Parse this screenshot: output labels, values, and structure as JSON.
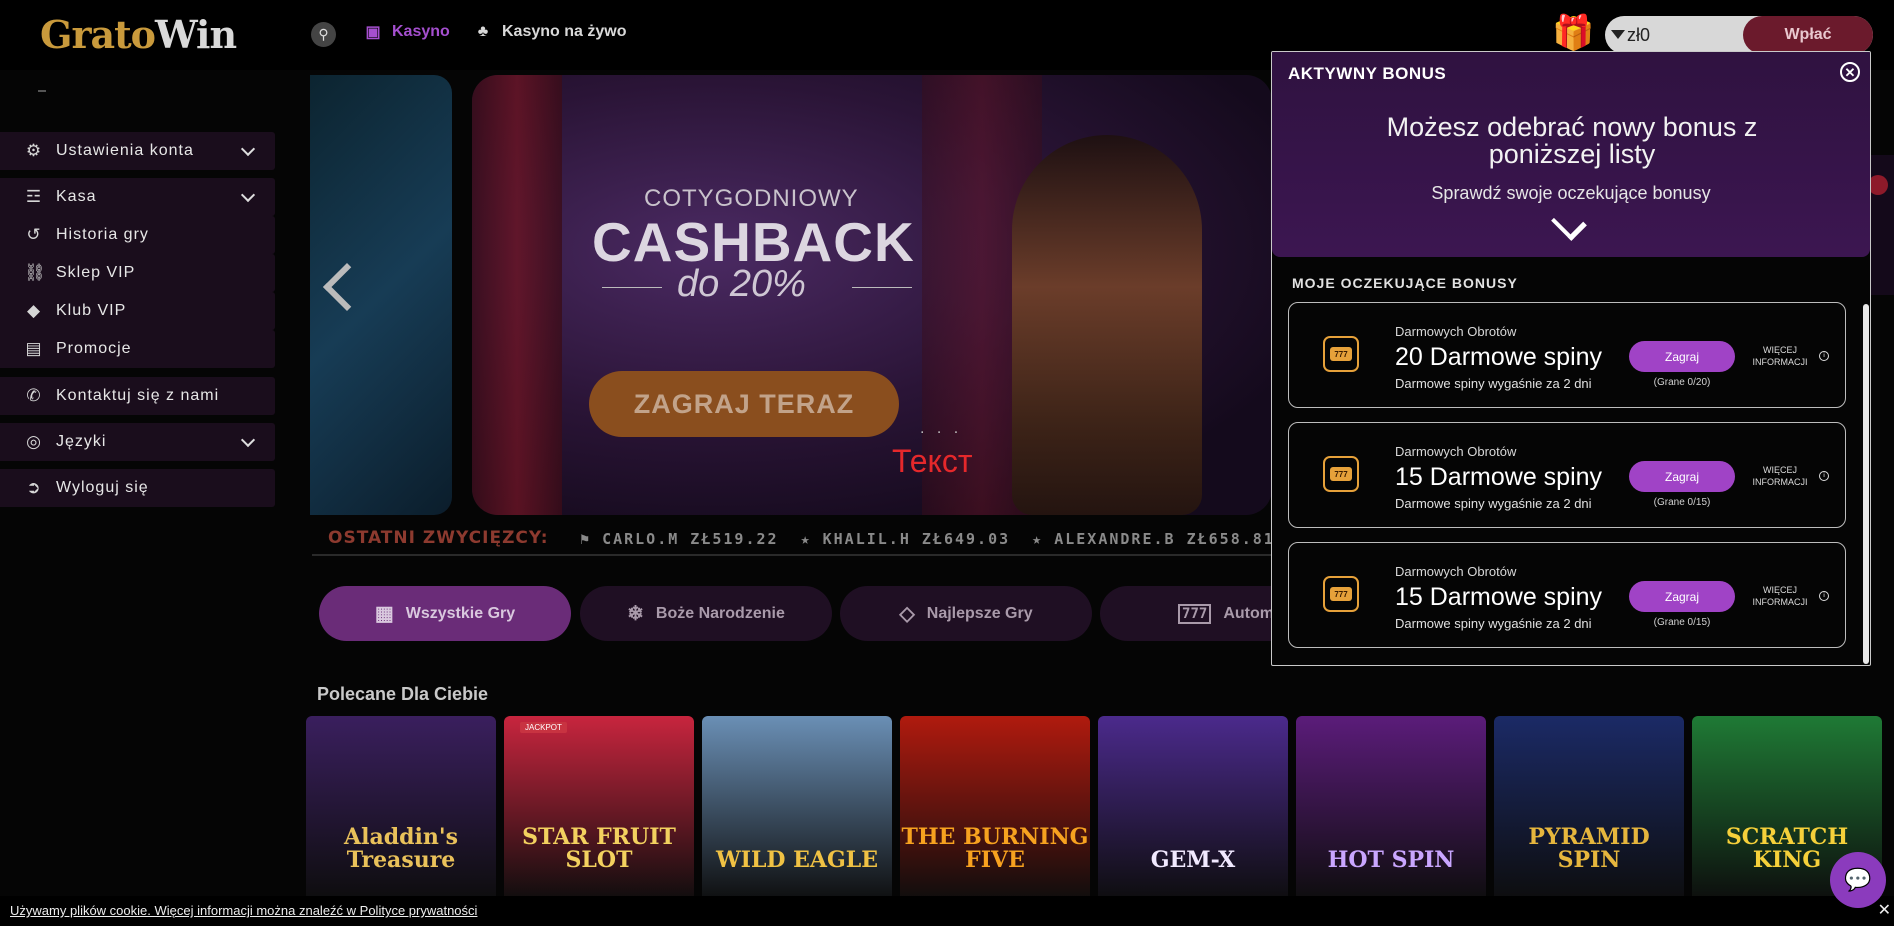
{
  "header": {
    "logo": {
      "part1": "Grato",
      "part2": "Win"
    },
    "nav": [
      {
        "label": "Kasyno",
        "icon": "slot-machine-icon",
        "color": "#a54fcf"
      },
      {
        "label": "Kasyno na żywo",
        "icon": "live-dealer-icon",
        "color": "#d9d9d9"
      }
    ],
    "balance": "zł0",
    "deposit_label": "Wpłać"
  },
  "sidebar": {
    "items": [
      {
        "label": "Ustawienia konta",
        "icon": "gear-icon",
        "expandable": true
      },
      {
        "label": "Kasa",
        "icon": "cash-icon",
        "expandable": true
      },
      {
        "label": "Historia gry",
        "icon": "history-icon",
        "expandable": false
      },
      {
        "label": "Sklep VIP",
        "icon": "shop-icon",
        "expandable": false
      },
      {
        "label": "Klub VIP",
        "icon": "diamond-icon",
        "expandable": false
      },
      {
        "label": "Promocje",
        "icon": "gift-icon",
        "expandable": false
      },
      {
        "label": "Kontaktuj się z nami",
        "icon": "phone-icon",
        "expandable": false
      },
      {
        "label": "Języki",
        "icon": "globe-icon",
        "expandable": true
      },
      {
        "label": "Wyloguj się",
        "icon": "logout-icon",
        "expandable": false
      }
    ]
  },
  "banner": {
    "super": "COTYGODNIOWY",
    "title": "CASHBACK",
    "subtitle": "do 20%",
    "cta": "ZAGRAJ TERAZ",
    "dots": ". . .",
    "overlay_text": "Текст"
  },
  "winners": {
    "label": "OSTATNI ZWYCIĘZCY:",
    "entries": [
      "CARLO.M ZŁ519.22",
      "KHALIL.H ZŁ649.03",
      "ALEXANDRE.B ZŁ658.81"
    ]
  },
  "categories": [
    {
      "label": "Wszystkie Gry",
      "icon": "grid-icon",
      "active": true
    },
    {
      "label": "Boże Narodzenie",
      "icon": "christmas-icon",
      "active": false
    },
    {
      "label": "Najlepsze Gry",
      "icon": "diamond-icon",
      "active": false
    },
    {
      "label": "Autom",
      "icon": "777-icon",
      "active": false
    }
  ],
  "recommended": {
    "title": "Polecane Dla Ciebie",
    "games": [
      {
        "name": "Aladdin's Treasure",
        "bg": "#3a1f5e",
        "fg": "#e9c15a"
      },
      {
        "name": "STAR FRUIT SLOT",
        "bg": "#c8253e",
        "fg": "#f3d15f",
        "badge": "JACKPOT"
      },
      {
        "name": "WILD EAGLE",
        "bg": "#6a8fb5",
        "fg": "#f0c244"
      },
      {
        "name": "THE BURNING FIVE",
        "bg": "#b01a0e",
        "fg": "#f7a21f"
      },
      {
        "name": "GEM-X",
        "bg": "#4b2a8c",
        "fg": "#f1e9ff"
      },
      {
        "name": "HOT SPIN",
        "bg": "#5b1c7a",
        "fg": "#c9a6ff"
      },
      {
        "name": "PYRAMID SPIN",
        "bg": "#1b2a66",
        "fg": "#e6b63d"
      },
      {
        "name": "SCRATCH KING",
        "bg": "#1f7a35",
        "fg": "#f5d03a"
      }
    ]
  },
  "bonus_panel": {
    "title": "AKTYWNY BONUS",
    "headline": "Możesz odebrać nowy bonus z poniższej listy",
    "check": "Sprawdź swoje oczekujące bonusy",
    "list_title": "MOJE OCZEKUJĄCE BONUSY",
    "cards": [
      {
        "category": "Darmowych Obrotów",
        "title": "20 Darmowe spiny",
        "expiry": "Darmowe spiny wygaśnie za 2 dni",
        "play": "Zagraj",
        "progress": "(Grane 0/20)",
        "more": "WIĘCEJ INFORMACJI"
      },
      {
        "category": "Darmowych Obrotów",
        "title": "15 Darmowe spiny",
        "expiry": "Darmowe spiny wygaśnie za 2 dni",
        "play": "Zagraj",
        "progress": "(Grane 0/15)",
        "more": "WIĘCEJ INFORMACJI"
      },
      {
        "category": "Darmowych Obrotów",
        "title": "15 Darmowe spiny",
        "expiry": "Darmowe spiny wygaśnie za 2 dni",
        "play": "Zagraj",
        "progress": "(Grane 0/15)",
        "more": "WIĘCEJ INFORMACJI"
      }
    ],
    "slot_icon_text": "777"
  },
  "cookie": {
    "text": "Używamy plików cookie. Więcej informacji można znaleźć w Polityce prywatności",
    "close": "✕"
  }
}
